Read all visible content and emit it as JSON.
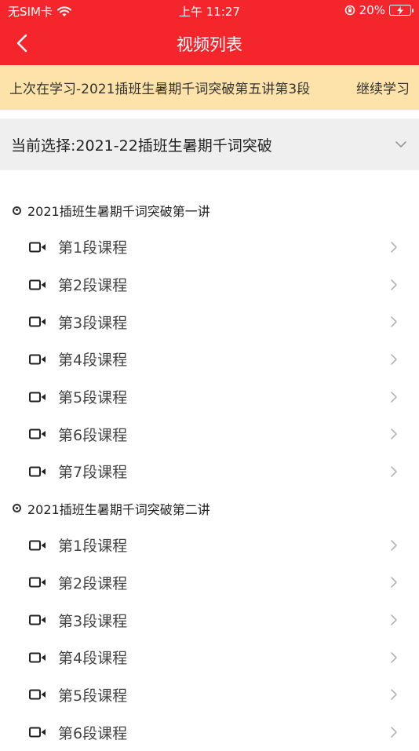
{
  "status_bar": {
    "carrier": "无SIM卡",
    "time": "上午 11:27",
    "battery": "20%"
  },
  "nav": {
    "title": "视频列表"
  },
  "resume": {
    "text": "上次在学习-2021插班生暑期千词突破第五讲第3段",
    "button": "继续学习"
  },
  "selection": {
    "text": "当前选择:2021-22插班生暑期千词突破"
  },
  "sections": [
    {
      "title": "2021插班生暑期千词突破第一讲",
      "lessons": [
        "第1段课程",
        "第2段课程",
        "第3段课程",
        "第4段课程",
        "第5段课程",
        "第6段课程",
        "第7段课程"
      ]
    },
    {
      "title": "2021插班生暑期千词突破第二讲",
      "lessons": [
        "第1段课程",
        "第2段课程",
        "第3段课程",
        "第4段课程",
        "第5段课程",
        "第6段课程"
      ]
    }
  ],
  "colors": {
    "header": "#f5262b",
    "resume_bg": "#fde3a9",
    "select_bg": "#efefef"
  }
}
